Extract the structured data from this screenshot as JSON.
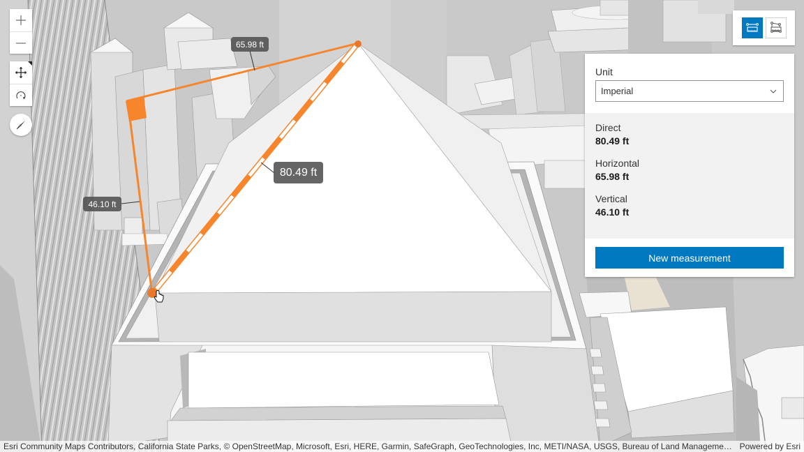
{
  "navigation": {
    "zoom_in": "zoom-in",
    "zoom_out": "zoom-out",
    "pan_mode": "pan",
    "rotate_mode": "rotate",
    "compass": "compass"
  },
  "tools": {
    "items": [
      {
        "id": "direct-line-measurement",
        "active": true
      },
      {
        "id": "area-measurement",
        "active": false
      }
    ]
  },
  "panel": {
    "unit_label": "Unit",
    "unit_value": "Imperial",
    "results": [
      {
        "label": "Direct",
        "value": "80.49 ft"
      },
      {
        "label": "Horizontal",
        "value": "65.98 ft"
      },
      {
        "label": "Vertical",
        "value": "46.10 ft"
      }
    ],
    "new_measurement_label": "New measurement"
  },
  "map_labels": {
    "direct": "80.49 ft",
    "horizontal": "65.98 ft",
    "vertical": "46.10 ft"
  },
  "attribution": {
    "text": "Esri Community Maps Contributors, California State Parks, © OpenStreetMap, Microsoft, Esri, HERE, Garmin, SafeGraph, GeoTechnologies, Inc, METI/NASA, USGS, Bureau of Land Manageme…",
    "powered_by": "Powered by Esri"
  },
  "colors": {
    "accent": "#0079c1",
    "measurement": "#f7852c",
    "label_bg": "#505050"
  }
}
